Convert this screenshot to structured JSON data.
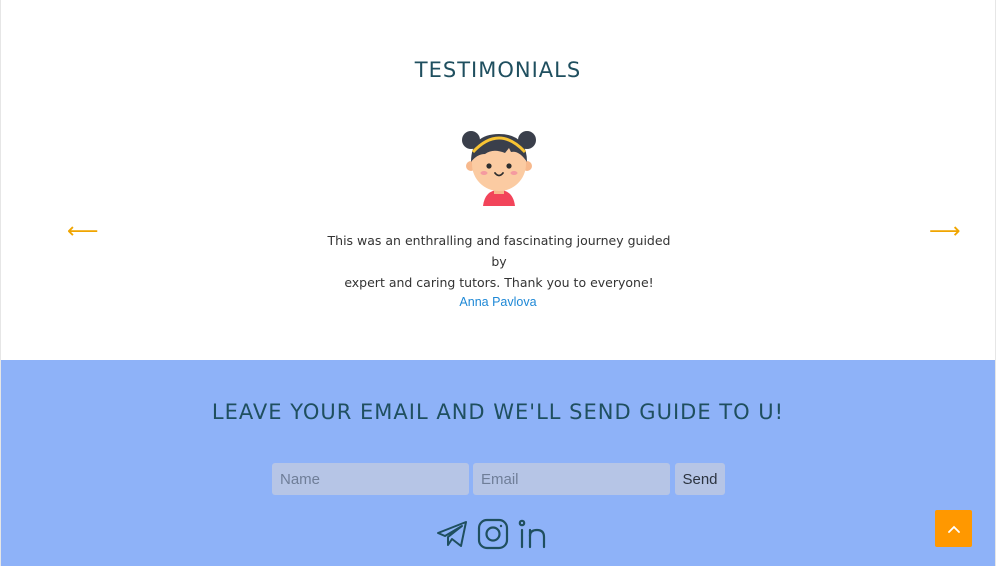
{
  "testimonials": {
    "title": "TESTIMONIALS",
    "prev_arrow": "⟵",
    "next_arrow": "⟶",
    "quote_line1": "This was an enthralling and fascinating journey guided by",
    "quote_line2": "expert and caring tutors. Thank you to everyone!",
    "author": "Anna Pavlova"
  },
  "subscribe": {
    "title": "LEAVE YOUR EMAIL AND WE'LL SEND GUIDE TO U!",
    "name_placeholder": "Name",
    "email_placeholder": "Email",
    "send_label": "Send",
    "social_icons": [
      "telegram-icon",
      "instagram-icon",
      "linkedin-icon"
    ]
  },
  "colors": {
    "heading": "#1f4f5f",
    "arrow": "#f0a500",
    "author_link": "#1e88d6",
    "subscribe_bg": "#8eb2f8",
    "field_bg": "#b6c5e6",
    "to_top_bg": "#ff9800"
  }
}
